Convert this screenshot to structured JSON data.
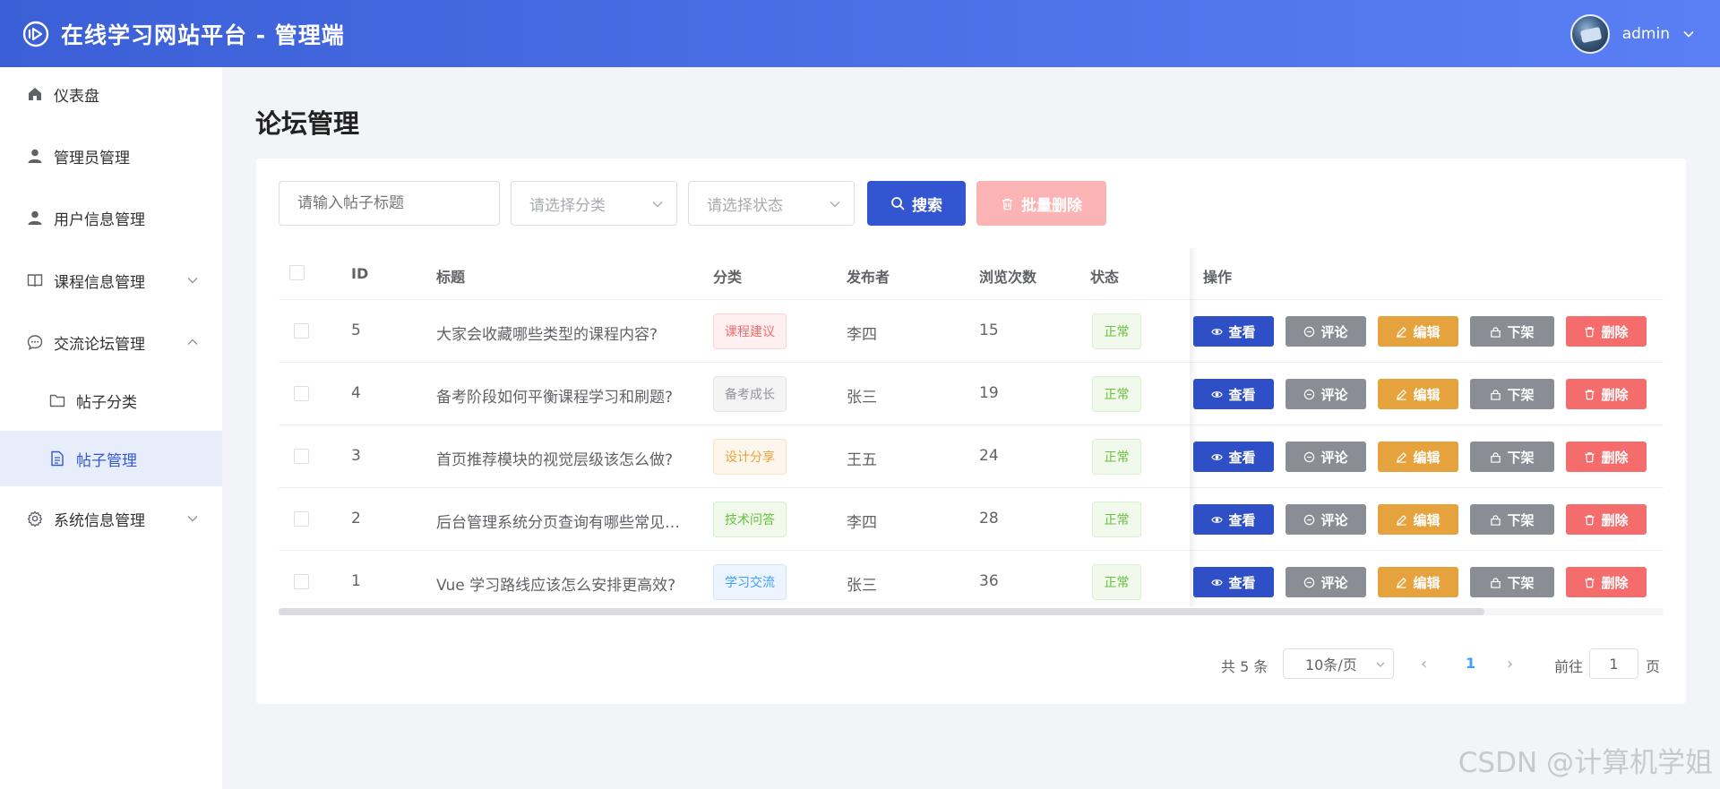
{
  "header": {
    "title": "在线学习网站平台 - 管理端",
    "user_name": "admin"
  },
  "sidebar": {
    "items": [
      {
        "label": "仪表盘",
        "icon": "home-icon"
      },
      {
        "label": "管理员管理",
        "icon": "user-icon"
      },
      {
        "label": "用户信息管理",
        "icon": "user-icon"
      },
      {
        "label": "课程信息管理",
        "icon": "book-icon",
        "expanded": false
      },
      {
        "label": "交流论坛管理",
        "icon": "chat-icon",
        "expanded": true
      },
      {
        "label": "帖子分类",
        "icon": "folder-icon",
        "sub": true
      },
      {
        "label": "帖子管理",
        "icon": "document-icon",
        "sub": true,
        "active": true
      },
      {
        "label": "系统信息管理",
        "icon": "gear-icon",
        "expanded": false
      }
    ]
  },
  "page": {
    "title": "论坛管理"
  },
  "filters": {
    "title_placeholder": "请输入帖子标题",
    "category_placeholder": "请选择分类",
    "status_placeholder": "请选择状态",
    "search_label": "搜索",
    "batch_delete_label": "批量删除"
  },
  "table": {
    "headers": {
      "id": "ID",
      "title": "标题",
      "category": "分类",
      "author": "发布者",
      "views": "浏览次数",
      "status": "状态",
      "actions": "操作"
    },
    "rows": [
      {
        "id": "5",
        "title": "大家会收藏哪些类型的课程内容?",
        "category": "课程建议",
        "author": "李四",
        "views": "15",
        "status": "正常"
      },
      {
        "id": "4",
        "title": "备考阶段如何平衡课程学习和刷题?",
        "category": "备考成长",
        "author": "张三",
        "views": "19",
        "status": "正常"
      },
      {
        "id": "3",
        "title": "首页推荐模块的视觉层级该怎么做?",
        "category": "设计分享",
        "author": "王五",
        "views": "24",
        "status": "正常"
      },
      {
        "id": "2",
        "title": "后台管理系统分页查询有哪些常见…",
        "category": "技术问答",
        "author": "李四",
        "views": "28",
        "status": "正常"
      },
      {
        "id": "1",
        "title": "Vue 学习路线应该怎么安排更高效?",
        "category": "学习交流",
        "author": "张三",
        "views": "36",
        "status": "正常"
      }
    ],
    "actions": {
      "view": "查看",
      "comment": "评论",
      "edit": "编辑",
      "off": "下架",
      "delete": "删除"
    }
  },
  "pagination": {
    "total": "共 5 条",
    "page_size": "10条/页",
    "current_page": "1",
    "goto_label": "前往",
    "goto_value": "1",
    "page_label": "页"
  },
  "watermark": "CSDN @计算机学姐",
  "colors": {
    "primary": "#3455d1",
    "danger": "#f56c6c",
    "warning": "#e6a23c",
    "info": "#8a8d93",
    "success": "#67c23a"
  }
}
